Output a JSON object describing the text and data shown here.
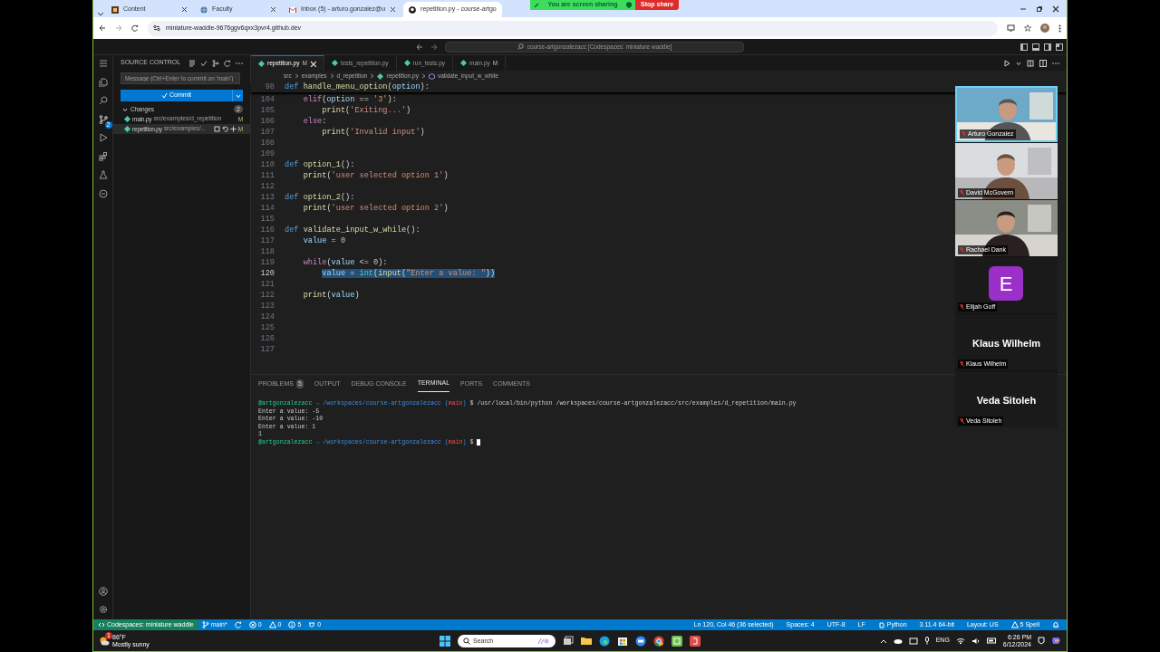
{
  "browser": {
    "tabs": [
      {
        "title": "Content",
        "selected": false
      },
      {
        "title": "Faculty",
        "selected": false
      },
      {
        "title": "Inbox (5) - arturo.gonzalez@u",
        "selected": false
      },
      {
        "title": "repetition.py - course-artgo",
        "selected": true
      }
    ],
    "share_status": "You are screen sharing",
    "stop_share": "Stop share",
    "url": "miniature-waddle-9676ggv6qxx3pvr4.github.dev"
  },
  "vscode": {
    "command_center": "course-artgonzalezacc [Codespaces: miniature waddle]",
    "activity_badge": "2",
    "source_control": {
      "title": "SOURCE CONTROL",
      "message_placeholder": "Message (Ctrl+Enter to commit on 'main')",
      "commit": "Commit",
      "changes_label": "Changes",
      "changes_count": "2",
      "files": [
        {
          "name": "main.py",
          "path": "src/examples/d_repetition",
          "status": "M",
          "selected": false
        },
        {
          "name": "repetition.py",
          "path": "src/examples/...",
          "status": "M",
          "selected": true
        }
      ]
    },
    "editor_tabs": [
      {
        "label": "repetition.py",
        "status": "M",
        "selected": true
      },
      {
        "label": "tests_repetition.py",
        "selected": false
      },
      {
        "label": "run_tests.py",
        "selected": false
      },
      {
        "label": "main.py",
        "status": "M",
        "selected": false
      }
    ],
    "breadcrumbs": [
      {
        "text": "src",
        "kind": "folder"
      },
      {
        "text": "examples",
        "kind": "folder"
      },
      {
        "text": "d_repetition",
        "kind": "folder"
      },
      {
        "text": "repetition.py",
        "kind": "file"
      },
      {
        "text": "validate_input_w_while",
        "kind": "symbol"
      }
    ],
    "code_lines": [
      {
        "number": "98",
        "sticky": true,
        "selected": false,
        "tokens": [
          {
            "text": "def ",
            "kind": "keyword"
          },
          {
            "text": "handle_menu_option",
            "kind": "function"
          },
          {
            "text": "(",
            "kind": "plain"
          },
          {
            "text": "option",
            "kind": "variable"
          },
          {
            "text": "):",
            "kind": "plain"
          }
        ]
      },
      {
        "number": "104",
        "sticky": false,
        "selected": false,
        "tokens": [
          {
            "text": "    elif",
            "kind": "control"
          },
          {
            "text": "(",
            "kind": "plain"
          },
          {
            "text": "option",
            "kind": "variable"
          },
          {
            "text": " == ",
            "kind": "plain"
          },
          {
            "text": "'3'",
            "kind": "string"
          },
          {
            "text": "):",
            "kind": "plain"
          }
        ]
      },
      {
        "number": "105",
        "sticky": false,
        "selected": false,
        "tokens": [
          {
            "text": "        print",
            "kind": "function"
          },
          {
            "text": "(",
            "kind": "plain"
          },
          {
            "text": "'Exiting...'",
            "kind": "string"
          },
          {
            "text": ")",
            "kind": "plain"
          }
        ]
      },
      {
        "number": "106",
        "sticky": false,
        "selected": false,
        "tokens": [
          {
            "text": "    else",
            "kind": "control"
          },
          {
            "text": ":",
            "kind": "plain"
          }
        ]
      },
      {
        "number": "107",
        "sticky": false,
        "selected": false,
        "tokens": [
          {
            "text": "        print",
            "kind": "function"
          },
          {
            "text": "(",
            "kind": "plain"
          },
          {
            "text": "'Invalid input'",
            "kind": "string"
          },
          {
            "text": ")",
            "kind": "plain"
          }
        ]
      },
      {
        "number": "108",
        "sticky": false,
        "selected": false
      },
      {
        "number": "109",
        "sticky": false,
        "selected": false
      },
      {
        "number": "110",
        "sticky": false,
        "selected": false,
        "tokens": [
          {
            "text": "def ",
            "kind": "keyword"
          },
          {
            "text": "option_1",
            "kind": "function"
          },
          {
            "text": "():",
            "kind": "plain"
          }
        ]
      },
      {
        "number": "111",
        "sticky": false,
        "selected": false,
        "tokens": [
          {
            "text": "    print",
            "kind": "function"
          },
          {
            "text": "(",
            "kind": "plain"
          },
          {
            "text": "'user selected option 1'",
            "kind": "string"
          },
          {
            "text": ")",
            "kind": "plain"
          }
        ]
      },
      {
        "number": "112",
        "sticky": false,
        "selected": false
      },
      {
        "number": "113",
        "sticky": false,
        "selected": false,
        "tokens": [
          {
            "text": "def ",
            "kind": "keyword"
          },
          {
            "text": "option_2",
            "kind": "function"
          },
          {
            "text": "():",
            "kind": "plain"
          }
        ]
      },
      {
        "number": "114",
        "sticky": false,
        "selected": false,
        "tokens": [
          {
            "text": "    print",
            "kind": "function"
          },
          {
            "text": "(",
            "kind": "plain"
          },
          {
            "text": "'user selected option 2'",
            "kind": "string"
          },
          {
            "text": ")",
            "kind": "plain"
          }
        ]
      },
      {
        "number": "115",
        "sticky": false,
        "selected": false
      },
      {
        "number": "116",
        "sticky": false,
        "selected": false,
        "tokens": [
          {
            "text": "def ",
            "kind": "keyword"
          },
          {
            "text": "validate_input_w_while",
            "kind": "function"
          },
          {
            "text": "():",
            "kind": "plain"
          }
        ]
      },
      {
        "number": "117",
        "sticky": false,
        "selected": false,
        "tokens": [
          {
            "text": "    value",
            "kind": "variable"
          },
          {
            "text": " = ",
            "kind": "plain"
          },
          {
            "text": "0",
            "kind": "number"
          }
        ]
      },
      {
        "number": "118",
        "sticky": false,
        "selected": false
      },
      {
        "number": "119",
        "sticky": false,
        "selected": false,
        "tokens": [
          {
            "text": "    while",
            "kind": "control"
          },
          {
            "text": "(",
            "kind": "plain"
          },
          {
            "text": "value",
            "kind": "variable"
          },
          {
            "text": " <= ",
            "kind": "plain"
          },
          {
            "text": "0",
            "kind": "number"
          },
          {
            "text": "):",
            "kind": "plain"
          }
        ]
      },
      {
        "number": "120",
        "sticky": false,
        "selected": true,
        "tokens": [
          {
            "text": "        value",
            "kind": "variable"
          },
          {
            "text": " = ",
            "kind": "plain"
          },
          {
            "text": "int",
            "kind": "class"
          },
          {
            "text": "(",
            "kind": "plain"
          },
          {
            "text": "input",
            "kind": "function"
          },
          {
            "text": "(",
            "kind": "plain"
          },
          {
            "text": "\"Enter a value: \"",
            "kind": "string"
          },
          {
            "text": "))",
            "kind": "plain"
          }
        ]
      },
      {
        "number": "121",
        "sticky": false,
        "selected": false
      },
      {
        "number": "122",
        "sticky": false,
        "selected": false,
        "tokens": [
          {
            "text": "    print",
            "kind": "function"
          },
          {
            "text": "(",
            "kind": "plain"
          },
          {
            "text": "value",
            "kind": "variable"
          },
          {
            "text": ")",
            "kind": "plain"
          }
        ]
      },
      {
        "number": "123",
        "sticky": false,
        "selected": false
      },
      {
        "number": "124",
        "sticky": false,
        "selected": false
      },
      {
        "number": "125",
        "sticky": false,
        "selected": false
      },
      {
        "number": "126",
        "sticky": false,
        "selected": false
      },
      {
        "number": "127",
        "sticky": false,
        "selected": false
      }
    ],
    "panel_tabs": [
      {
        "label": "PROBLEMS",
        "count": "5",
        "selected": false
      },
      {
        "label": "OUTPUT",
        "selected": false
      },
      {
        "label": "DEBUG CONSOLE",
        "selected": false
      },
      {
        "label": "TERMINAL",
        "selected": true
      },
      {
        "label": "PORTS",
        "selected": false
      },
      {
        "label": "COMMENTS",
        "selected": false
      }
    ],
    "terminal_lines": [
      {
        "segments": [
          {
            "text": "@artgonzalezacc ",
            "kind": "user"
          },
          {
            "text": "→ /workspaces/course-artgonzalezacc (",
            "kind": "path"
          },
          {
            "text": "main",
            "kind": "branch"
          },
          {
            "text": ")",
            "kind": "path"
          },
          {
            "text": " $ /usr/local/bin/python /workspaces/course-artgonzalezacc/src/examples/d_repetition/main.py",
            "kind": "plain"
          }
        ]
      },
      {
        "segments": [
          {
            "text": "Enter a value: -5",
            "kind": "plain"
          }
        ]
      },
      {
        "segments": [
          {
            "text": "Enter a value: -10",
            "kind": "plain"
          }
        ]
      },
      {
        "segments": [
          {
            "text": "Enter a value: 1",
            "kind": "plain"
          }
        ]
      },
      {
        "segments": [
          {
            "text": "1",
            "kind": "plain"
          }
        ]
      },
      {
        "segments": [
          {
            "text": "@artgonzalezacc ",
            "kind": "user"
          },
          {
            "text": "→ /workspaces/course-artgonzalezacc (",
            "kind": "path"
          },
          {
            "text": "main",
            "kind": "branch"
          },
          {
            "text": ")",
            "kind": "path"
          },
          {
            "text": " $",
            "kind": "plain"
          }
        ],
        "cursor": true
      }
    ],
    "status_left": [
      {
        "kind": "remote",
        "text": "Codespaces: miniature waddle"
      },
      {
        "kind": "branch",
        "text": "main*"
      },
      {
        "kind": "sync"
      },
      {
        "kind": "errors",
        "text": "0"
      },
      {
        "kind": "warnings",
        "text": "0"
      },
      {
        "kind": "info",
        "text": "5"
      },
      {
        "kind": "ports",
        "text": "0"
      }
    ],
    "status_right": [
      {
        "kind": "text",
        "text": "Ln 120, Col 46 (36 selected)"
      },
      {
        "kind": "text",
        "text": "Spaces: 4"
      },
      {
        "kind": "text",
        "text": "UTF-8"
      },
      {
        "kind": "text",
        "text": "LF"
      },
      {
        "kind": "language",
        "text": "Python"
      },
      {
        "kind": "text",
        "text": "3.11.4 64-bit"
      },
      {
        "kind": "text",
        "text": "Layout: US"
      },
      {
        "kind": "spell",
        "text": "5 Spell"
      },
      {
        "kind": "bell"
      }
    ]
  },
  "meeting": {
    "participants": [
      {
        "name": "Arturo Gonzalez",
        "kind": "video"
      },
      {
        "name": "David McGovern",
        "kind": "video"
      },
      {
        "name": "Rachael Dank",
        "kind": "video"
      },
      {
        "name": "Elijah Goff",
        "kind": "avatar",
        "initial": "E"
      },
      {
        "name": "Klaus Wilhelm",
        "kind": "name_only",
        "display": "Klaus Wilhelm"
      },
      {
        "name": "Veda Sitoleh",
        "kind": "name_only",
        "display": "Veda Sitoleh"
      }
    ]
  },
  "taskbar": {
    "weather": {
      "alert": "1",
      "temperature": "86°F",
      "condition": "Mostly sunny"
    },
    "search_placeholder": "Search",
    "language": "ENG",
    "time": "6:26 PM",
    "date": "6/12/2024"
  }
}
